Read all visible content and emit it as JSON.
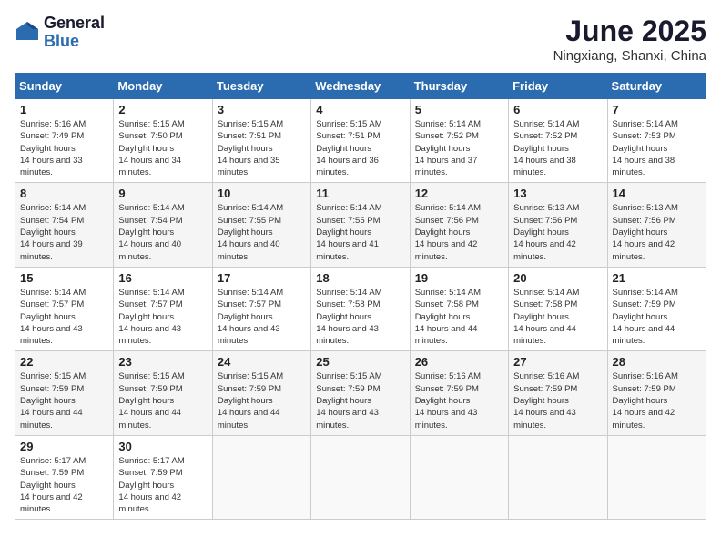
{
  "header": {
    "logo_line1": "General",
    "logo_line2": "Blue",
    "month": "June 2025",
    "location": "Ningxiang, Shanxi, China"
  },
  "columns": [
    "Sunday",
    "Monday",
    "Tuesday",
    "Wednesday",
    "Thursday",
    "Friday",
    "Saturday"
  ],
  "weeks": [
    [
      {
        "day": "1",
        "sunrise": "5:16 AM",
        "sunset": "7:49 PM",
        "daylight": "14 hours and 33 minutes."
      },
      {
        "day": "2",
        "sunrise": "5:15 AM",
        "sunset": "7:50 PM",
        "daylight": "14 hours and 34 minutes."
      },
      {
        "day": "3",
        "sunrise": "5:15 AM",
        "sunset": "7:51 PM",
        "daylight": "14 hours and 35 minutes."
      },
      {
        "day": "4",
        "sunrise": "5:15 AM",
        "sunset": "7:51 PM",
        "daylight": "14 hours and 36 minutes."
      },
      {
        "day": "5",
        "sunrise": "5:14 AM",
        "sunset": "7:52 PM",
        "daylight": "14 hours and 37 minutes."
      },
      {
        "day": "6",
        "sunrise": "5:14 AM",
        "sunset": "7:52 PM",
        "daylight": "14 hours and 38 minutes."
      },
      {
        "day": "7",
        "sunrise": "5:14 AM",
        "sunset": "7:53 PM",
        "daylight": "14 hours and 38 minutes."
      }
    ],
    [
      {
        "day": "8",
        "sunrise": "5:14 AM",
        "sunset": "7:54 PM",
        "daylight": "14 hours and 39 minutes."
      },
      {
        "day": "9",
        "sunrise": "5:14 AM",
        "sunset": "7:54 PM",
        "daylight": "14 hours and 40 minutes."
      },
      {
        "day": "10",
        "sunrise": "5:14 AM",
        "sunset": "7:55 PM",
        "daylight": "14 hours and 40 minutes."
      },
      {
        "day": "11",
        "sunrise": "5:14 AM",
        "sunset": "7:55 PM",
        "daylight": "14 hours and 41 minutes."
      },
      {
        "day": "12",
        "sunrise": "5:14 AM",
        "sunset": "7:56 PM",
        "daylight": "14 hours and 42 minutes."
      },
      {
        "day": "13",
        "sunrise": "5:13 AM",
        "sunset": "7:56 PM",
        "daylight": "14 hours and 42 minutes."
      },
      {
        "day": "14",
        "sunrise": "5:13 AM",
        "sunset": "7:56 PM",
        "daylight": "14 hours and 42 minutes."
      }
    ],
    [
      {
        "day": "15",
        "sunrise": "5:14 AM",
        "sunset": "7:57 PM",
        "daylight": "14 hours and 43 minutes."
      },
      {
        "day": "16",
        "sunrise": "5:14 AM",
        "sunset": "7:57 PM",
        "daylight": "14 hours and 43 minutes."
      },
      {
        "day": "17",
        "sunrise": "5:14 AM",
        "sunset": "7:57 PM",
        "daylight": "14 hours and 43 minutes."
      },
      {
        "day": "18",
        "sunrise": "5:14 AM",
        "sunset": "7:58 PM",
        "daylight": "14 hours and 43 minutes."
      },
      {
        "day": "19",
        "sunrise": "5:14 AM",
        "sunset": "7:58 PM",
        "daylight": "14 hours and 44 minutes."
      },
      {
        "day": "20",
        "sunrise": "5:14 AM",
        "sunset": "7:58 PM",
        "daylight": "14 hours and 44 minutes."
      },
      {
        "day": "21",
        "sunrise": "5:14 AM",
        "sunset": "7:59 PM",
        "daylight": "14 hours and 44 minutes."
      }
    ],
    [
      {
        "day": "22",
        "sunrise": "5:15 AM",
        "sunset": "7:59 PM",
        "daylight": "14 hours and 44 minutes."
      },
      {
        "day": "23",
        "sunrise": "5:15 AM",
        "sunset": "7:59 PM",
        "daylight": "14 hours and 44 minutes."
      },
      {
        "day": "24",
        "sunrise": "5:15 AM",
        "sunset": "7:59 PM",
        "daylight": "14 hours and 44 minutes."
      },
      {
        "day": "25",
        "sunrise": "5:15 AM",
        "sunset": "7:59 PM",
        "daylight": "14 hours and 43 minutes."
      },
      {
        "day": "26",
        "sunrise": "5:16 AM",
        "sunset": "7:59 PM",
        "daylight": "14 hours and 43 minutes."
      },
      {
        "day": "27",
        "sunrise": "5:16 AM",
        "sunset": "7:59 PM",
        "daylight": "14 hours and 43 minutes."
      },
      {
        "day": "28",
        "sunrise": "5:16 AM",
        "sunset": "7:59 PM",
        "daylight": "14 hours and 42 minutes."
      }
    ],
    [
      {
        "day": "29",
        "sunrise": "5:17 AM",
        "sunset": "7:59 PM",
        "daylight": "14 hours and 42 minutes."
      },
      {
        "day": "30",
        "sunrise": "5:17 AM",
        "sunset": "7:59 PM",
        "daylight": "14 hours and 42 minutes."
      },
      null,
      null,
      null,
      null,
      null
    ]
  ]
}
